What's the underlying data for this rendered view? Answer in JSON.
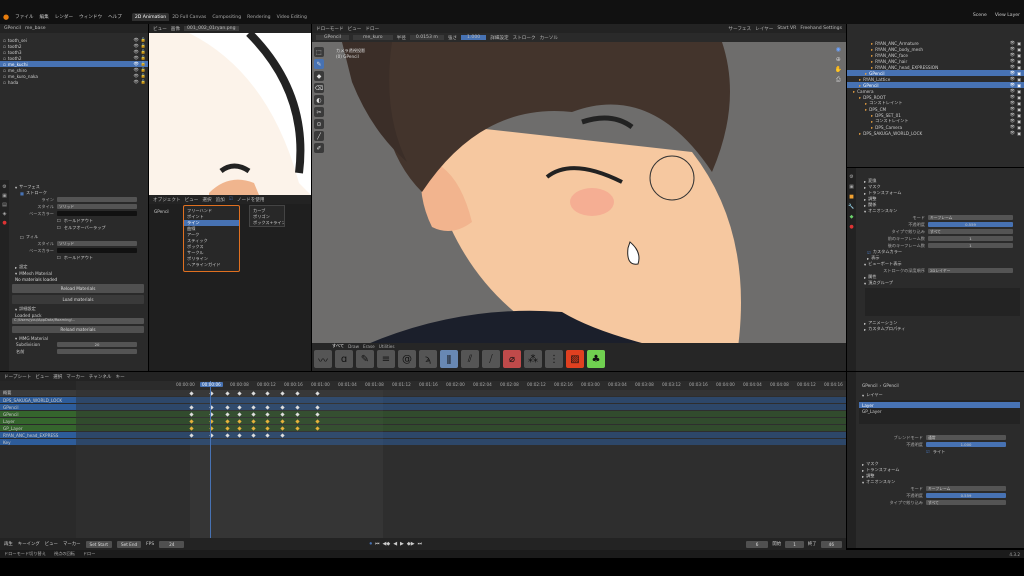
{
  "menu": {
    "items": [
      "ファイル",
      "編集",
      "レンダー",
      "ウィンドウ",
      "ヘルプ"
    ],
    "workspaces": [
      "2D Animation",
      "2D Full Canvas",
      "Compositing",
      "Rendering",
      "Video Editing"
    ],
    "active_workspace": "2D Animation",
    "scene": "Scene",
    "layer": "View Layer"
  },
  "outliner_left": {
    "header": "GPencil",
    "mode": "me_base",
    "items": [
      "tooth_sei",
      "tooth2",
      "tooth3",
      "tooth2",
      "me_kuchi",
      "me_shiro",
      "me_kuro_naka",
      "hada"
    ],
    "selected": "me_kuchi"
  },
  "left_props": {
    "section_surface": "サーフェス",
    "section_stroke": "ストローク",
    "line_type": "ライン",
    "style": "スタイル",
    "style_val": "ソリッド",
    "base_color": "ベースカラー",
    "holdout": "ホールドアウト",
    "self_overlap": "セルフオーバーラップ",
    "section_fill": "フィル",
    "fill_style": "ソリッド",
    "fill_holdout": "ホールドアウト",
    "settings": "設定",
    "mmt_header": "MMesh Material",
    "no_materials": "No materials loaded",
    "reload_btn": "Reload Materials",
    "load_btn": "Load materials",
    "settings2": "詳細設定",
    "loaded_header": "Loaded pack",
    "path": "C:/Users/you/AppData/Roaming/...",
    "reload_btn2": "Reload materials",
    "mmt_material": "MMG Material",
    "subdivision": "Subdivision",
    "subdiv_val": "20",
    "name": "名前",
    "material_name": "me_kuro"
  },
  "image_editor": {
    "menu": [
      "ビュー",
      "画像"
    ],
    "filename": "001_002_01ryan.png"
  },
  "viewport": {
    "mode": "ドローモード",
    "menu": [
      "ビュー",
      "ドロー"
    ],
    "object": "GPencil",
    "material": "me_kuro",
    "radius_label": "半径",
    "radius": "0.0153 m",
    "strength_label": "強さ",
    "strength": "1.000",
    "surface": "サーフェス",
    "layer": "レイヤー",
    "settings": "詳細設定",
    "stroke": "ストローク",
    "cursor": "カーソル",
    "start_vr": "Start VR",
    "freehand": "Freehand Settings",
    "camera_label": "カメラ透視投影",
    "collection": "(0) GPencil",
    "brush_tabs": [
      "すべて",
      "Draw",
      "Erase",
      "Utilities"
    ]
  },
  "popup": {
    "header": "オブジェクト",
    "tabs": [
      "ビュー",
      "選択",
      "追加",
      "ノード"
    ],
    "items": [
      "フリーハンド",
      "ポイント",
      "ライン",
      "曲線",
      "アーク",
      "スティック",
      "ボックス",
      "サークル",
      "ポリライン",
      "ヘアラインガイド"
    ],
    "selected": "ライン",
    "sub": [
      "カーブ",
      "ポリゴン",
      "ボックス+ライン"
    ]
  },
  "node_editor": {
    "obj": "GPencil",
    "checkbox": "ノードを使用"
  },
  "outliner_right": {
    "items": [
      "RYAN_ANC_Armature",
      "RYAN_ANC_body_mesh",
      "RYAN_ANC_face",
      "RYAN_ANC_hair",
      "RYAN_ANC_head_EXPRESSION",
      "GPencil",
      "RYAN_Lattice",
      "GPencil",
      "Camera",
      "DPS_ROOT",
      "コンストレイント",
      "DPS_CM",
      "DPS_SET_01",
      "コンストレイント",
      "DPS_Camera",
      "DPS_SAKUGA_WORLD_LOCK"
    ],
    "selected": "GPencil"
  },
  "right_props": {
    "section": "変換",
    "mask": "マスク",
    "transform": "トランスフォーム",
    "adjust": "調整",
    "relations": "関係",
    "onion": "オニオンスキン",
    "mode": "モード",
    "mode_val": "キーフレーム",
    "opacity": "不透明度",
    "opacity_val": "0.559",
    "filter_by_type": "タイプで絞り込み",
    "filter_val": "すべて",
    "before": "前のキーフレーム数",
    "before_val": "1",
    "after": "後のキーフレーム数",
    "after_val": "1",
    "custom_color": "カスタムカラー",
    "display": "表示",
    "viewport_display": "ビューポート表示",
    "stroke_depth": "ストロークの深度順序",
    "depth_val": "2Dレイヤー",
    "certain": "属性",
    "vertex_groups": "頂点グループ",
    "animation": "アニメーション",
    "custom_props": "カスタムプロパティ"
  },
  "timeline": {
    "mode": "ドープシート",
    "menu": [
      "ビュー",
      "選択",
      "マーカー",
      "チャンネル",
      "キー"
    ],
    "frame_labels": [
      "00:00:00",
      "00:00:04",
      "00:00:08",
      "00:00:12",
      "00:00:16",
      "00:01:00",
      "00:01:04",
      "00:01:08",
      "00:01:12",
      "00:01:16",
      "00:02:00",
      "00:02:04",
      "00:02:08",
      "00:02:12",
      "00:02:16",
      "00:03:00",
      "00:03:04",
      "00:03:08",
      "00:03:12",
      "00:03:16",
      "00:04:00",
      "00:04:04",
      "00:04:08",
      "00:04:12",
      "00:04:16",
      "00:05:00",
      "00:05:04",
      "00:05:08",
      "00:05:12",
      "00:05:16"
    ],
    "current": "00:00:06",
    "channels": [
      {
        "name": "概要",
        "color": "#3a3a3a"
      },
      {
        "name": "DPS_SAKUGA_WORLD_LOCK",
        "color": "#2d5c9a"
      },
      {
        "name": "GPencil",
        "color": "#2d5c9a"
      },
      {
        "name": "GPencil",
        "color": "#35652d"
      },
      {
        "name": "Layer",
        "color": "#35652d"
      },
      {
        "name": "GP_Layer",
        "color": "#35652d"
      },
      {
        "name": "RYAN_ANC_head_EXPRESS",
        "color": "#2d5c9a"
      },
      {
        "name": "Key",
        "color": "#2d5c9a"
      }
    ]
  },
  "gp_layers": {
    "obj": "GPencil",
    "data": "GPencil",
    "section": "レイヤー",
    "layers": [
      "Layer",
      "GP_Layer"
    ],
    "selected": "Layer",
    "blend": "ブレンドモード",
    "blend_val": "通常",
    "opacity": "不透明度",
    "opacity_val": "1.000",
    "lights": "ライト",
    "mask": "マスク",
    "transform": "トランスフォーム",
    "adjust": "調整",
    "onion": "オニオンスキン",
    "mode": "モード",
    "mode_val": "キーフレーム",
    "o_opacity": "不透明度",
    "o_opacity_val": "0.559",
    "filter": "タイプで絞り込み",
    "filter_val": "すべて"
  },
  "playback": {
    "menu": [
      "再生",
      "キーイング",
      "ビュー",
      "マーカー"
    ],
    "set_start": "Set Start",
    "set_end": "Set End",
    "fps_label": "FPS",
    "fps": "24",
    "frame": "6",
    "start_label": "開始",
    "start": "1",
    "end_label": "終了",
    "end": "46"
  },
  "status": {
    "left": "ドローモード切り替え",
    "mid": "視点の回転",
    "right": "ドロー",
    "version": "4.3.2"
  },
  "colors": {
    "select": "#4772b3",
    "accent": "#f5a623",
    "green": "#35652d"
  }
}
